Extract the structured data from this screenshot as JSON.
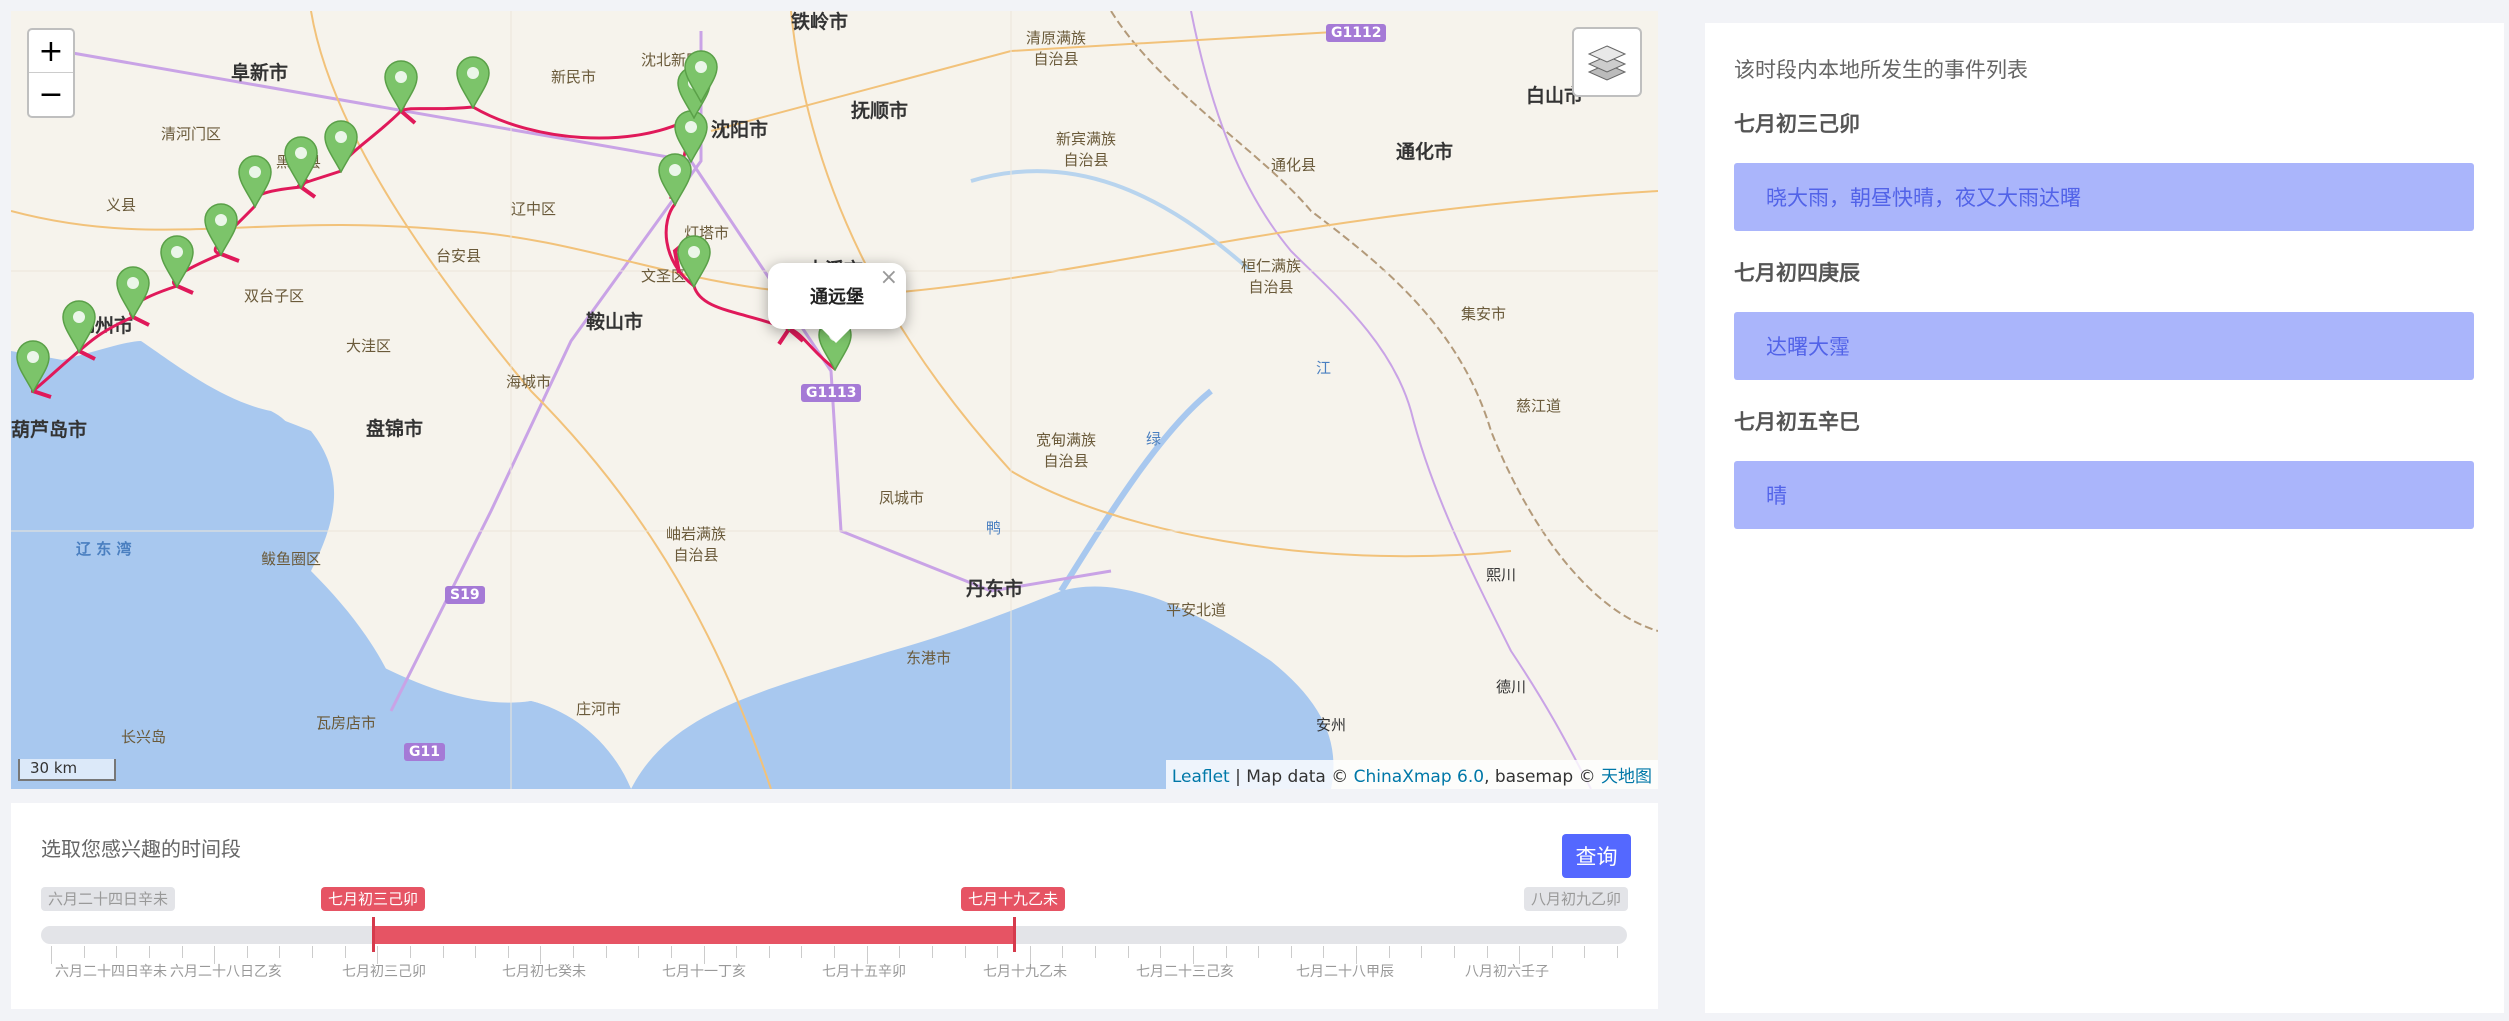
{
  "map": {
    "zoom_in": "+",
    "zoom_out": "−",
    "scale_label": "30 km",
    "popup": {
      "title": "通远堡",
      "close": "×"
    },
    "attribution": {
      "leaflet": "Leaflet",
      "sep1": " | Map data © ",
      "chinaxmap": "ChinaXmap 6.0",
      "sep2": ", basemap © ",
      "tianditu": "天地图"
    },
    "cities": [
      {
        "name": "阜新市",
        "cls": "big"
      },
      {
        "name": "铁岭市",
        "cls": "big"
      },
      {
        "name": "清原满族\n自治县",
        "cls": "small"
      },
      {
        "name": "沈北新区",
        "cls": "small"
      },
      {
        "name": "新民市",
        "cls": "small"
      },
      {
        "name": "沈阳市",
        "cls": "big"
      },
      {
        "name": "抚顺市",
        "cls": "big"
      },
      {
        "name": "清河门区",
        "cls": "small"
      },
      {
        "name": "黑山县",
        "cls": "small"
      },
      {
        "name": "新宾满族\n自治县",
        "cls": "small"
      },
      {
        "name": "通化县",
        "cls": "small"
      },
      {
        "name": "通化市",
        "cls": "big"
      },
      {
        "name": "白山市",
        "cls": "big"
      },
      {
        "name": "义县",
        "cls": "small"
      },
      {
        "name": "辽中区",
        "cls": "small"
      },
      {
        "name": "台安县",
        "cls": "small"
      },
      {
        "name": "灯塔市",
        "cls": "small"
      },
      {
        "name": "文圣区",
        "cls": "small"
      },
      {
        "name": "本溪市",
        "cls": "big"
      },
      {
        "name": "桓仁满族\n自治县",
        "cls": "small"
      },
      {
        "name": "双台子区",
        "cls": "small"
      },
      {
        "name": "锦州市",
        "cls": "big"
      },
      {
        "name": "鞍山市",
        "cls": "big"
      },
      {
        "name": "大洼区",
        "cls": "small"
      },
      {
        "name": "集安市",
        "cls": "small"
      },
      {
        "name": "海城市",
        "cls": "small"
      },
      {
        "name": "盘锦市",
        "cls": "big"
      },
      {
        "name": "葫芦岛市",
        "cls": "big"
      },
      {
        "name": "宽甸满族\n自治县",
        "cls": "small"
      },
      {
        "name": "慈江道",
        "cls": "small"
      },
      {
        "name": "凤城市",
        "cls": "small"
      },
      {
        "name": "岫岩满族\n自治县",
        "cls": "small"
      },
      {
        "name": "辽 东 湾",
        "cls": "small"
      },
      {
        "name": "鲅鱼圈区",
        "cls": "small"
      },
      {
        "name": "丹东市",
        "cls": "big"
      },
      {
        "name": "熙川",
        "cls": "small"
      },
      {
        "name": "平安北道",
        "cls": "small"
      },
      {
        "name": "东港市",
        "cls": "small"
      },
      {
        "name": "庄河市",
        "cls": "small"
      },
      {
        "name": "德川",
        "cls": "small"
      },
      {
        "name": "瓦房店市",
        "cls": "small"
      },
      {
        "name": "长兴岛",
        "cls": "small"
      },
      {
        "name": "安州",
        "cls": "small"
      },
      {
        "name": "鸭",
        "cls": "small"
      },
      {
        "name": "绿",
        "cls": "small"
      },
      {
        "name": "江",
        "cls": "small"
      }
    ],
    "shields": [
      "G1112",
      "G1113",
      "S19",
      "G11"
    ]
  },
  "timeline": {
    "title": "选取您感兴趣的时间段",
    "query_button": "查询",
    "start_label": "七月初三己卯",
    "end_label": "七月十九乙未",
    "min_label": "六月二十四日辛未",
    "max_label": "八月初九乙卯",
    "selected_range_fraction": [
      0.2103,
      0.6151
    ],
    "tick_labels": [
      "六月二十四日辛未",
      "六月二十八日乙亥",
      "七月初三己卯",
      "七月初七癸未",
      "七月十一丁亥",
      "七月十五辛卯",
      "七月十九乙未",
      "七月二十三己亥",
      "七月二十八甲辰",
      "八月初六壬子"
    ]
  },
  "panel": {
    "title": "该时段内本地所发生的事件列表",
    "events": [
      {
        "date": "七月初三己卯",
        "text": "晓大雨，朝昼快晴，夜又大雨达曙"
      },
      {
        "date": "七月初四庚辰",
        "text": "达曙大霪"
      },
      {
        "date": "七月初五辛巳",
        "text": "晴"
      }
    ]
  },
  "colors": {
    "route": "#e0195a",
    "marker": "#7cc46a",
    "event_bg": "#aab5fb",
    "event_text": "#5263e8",
    "accent": "#5468ff",
    "range": "#e65464",
    "sea": "#a8c8ef"
  }
}
